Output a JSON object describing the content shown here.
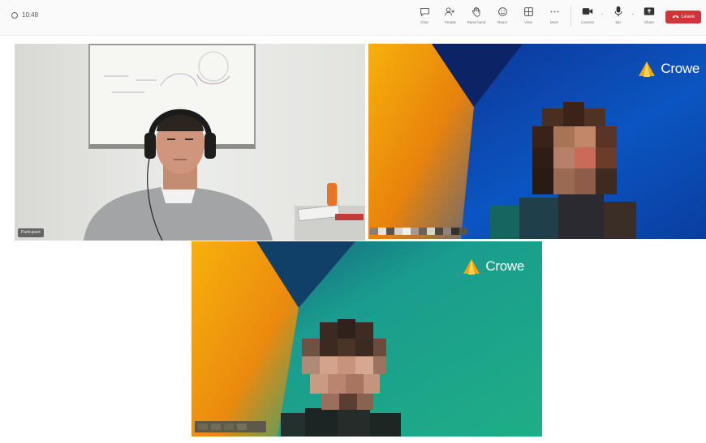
{
  "meeting": {
    "timer": "10:48",
    "controls": [
      {
        "name": "chat",
        "label": "Chat",
        "icon": "chat-icon"
      },
      {
        "name": "people",
        "label": "People",
        "icon": "people-icon"
      },
      {
        "name": "raise",
        "label": "Raise hand",
        "icon": "hand-icon"
      },
      {
        "name": "react",
        "label": "React",
        "icon": "emoji-icon"
      },
      {
        "name": "view",
        "label": "View",
        "icon": "grid-icon"
      },
      {
        "name": "more",
        "label": "More",
        "icon": "more-icon"
      },
      {
        "name": "camera",
        "label": "Camera",
        "icon": "camera-icon"
      },
      {
        "name": "mic",
        "label": "Mic",
        "icon": "mic-icon"
      },
      {
        "name": "share",
        "label": "Share",
        "icon": "share-icon"
      }
    ],
    "leave_label": "Leave"
  },
  "tiles": [
    {
      "id": "tile-1",
      "name_tag": "Participant",
      "logo": ""
    },
    {
      "id": "tile-2",
      "name_tag": "",
      "logo": "Crowe"
    },
    {
      "id": "tile-3",
      "name_tag": "",
      "logo": "Crowe"
    }
  ],
  "colors": {
    "leave": "#d13438",
    "crowe_blue": "#0a4fb5",
    "crowe_orange": "#f4a60b",
    "crowe_teal": "#1aa58a"
  }
}
